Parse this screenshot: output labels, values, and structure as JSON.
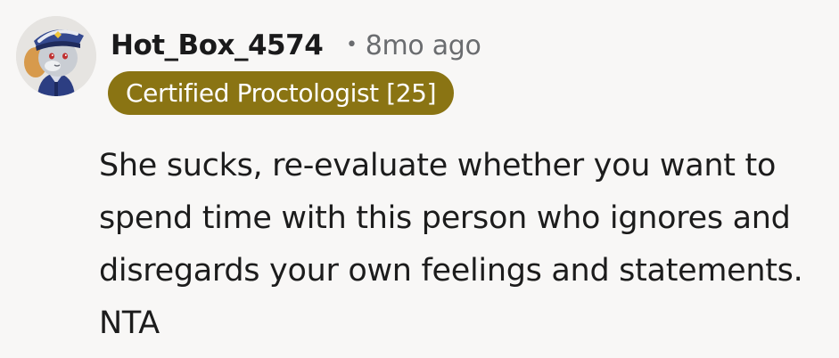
{
  "comment": {
    "author": "Hot_Box_4574",
    "separator": "•",
    "timestamp": "8mo ago",
    "flair": {
      "text": "Certified Proctologist [25]",
      "color": "#8a7413"
    },
    "avatar_icon": "police-cat-avatar",
    "body": "She sucks, re-evaluate whether you want to spend time with this person who ignores and disregards your own feelings and statements. NTA"
  }
}
